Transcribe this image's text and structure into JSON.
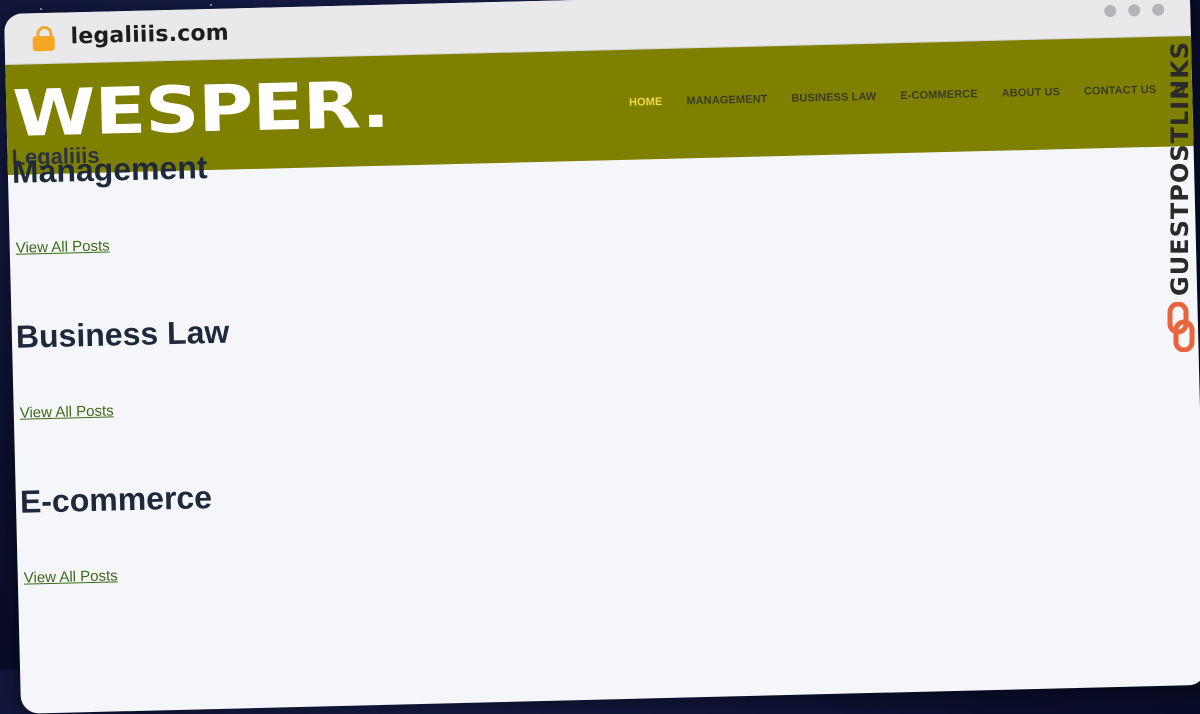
{
  "browser": {
    "url": "legaliiis.com",
    "lock_icon": "lock-icon",
    "window_dots": 3
  },
  "header": {
    "logo": "WESPER.",
    "site_name": "Legaliiis",
    "background_color": "#808000",
    "nav": [
      {
        "label": "HOME",
        "active": true
      },
      {
        "label": "MANAGEMENT",
        "active": false
      },
      {
        "label": "BUSINESS LAW",
        "active": false
      },
      {
        "label": "E-COMMERCE",
        "active": false
      },
      {
        "label": "ABOUT US",
        "active": false
      },
      {
        "label": "CONTACT US",
        "active": false
      }
    ],
    "search_icon": "search-icon"
  },
  "sections": [
    {
      "title": "Management",
      "link": "View All Posts"
    },
    {
      "title": "Business Law",
      "link": "View All Posts"
    },
    {
      "title": "E-commerce",
      "link": "View All Posts"
    }
  ],
  "watermark": {
    "text": "GUESTPOSTLINKS",
    "icon": "link-icon",
    "accent_color": "#e8643c"
  }
}
